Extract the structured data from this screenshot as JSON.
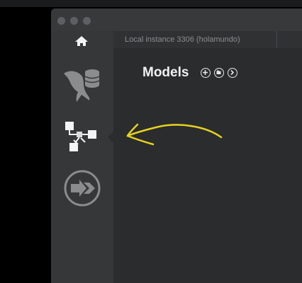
{
  "window": {
    "tab_label": "Local instance 3306 (holamundo)"
  },
  "sidebar": {
    "items": [
      {
        "icon": "home-icon"
      },
      {
        "icon": "mysql-connections-icon"
      },
      {
        "icon": "models-icon",
        "active": true
      },
      {
        "icon": "migration-icon"
      }
    ]
  },
  "main": {
    "title": "Models",
    "buttons": [
      {
        "icon": "add-model-icon"
      },
      {
        "icon": "open-model-icon"
      },
      {
        "icon": "more-options-icon"
      }
    ]
  },
  "colors": {
    "window_bg": "#2b2c2e",
    "sidebar_bg": "#363739",
    "annotation_arrow": "#e6d21e"
  }
}
